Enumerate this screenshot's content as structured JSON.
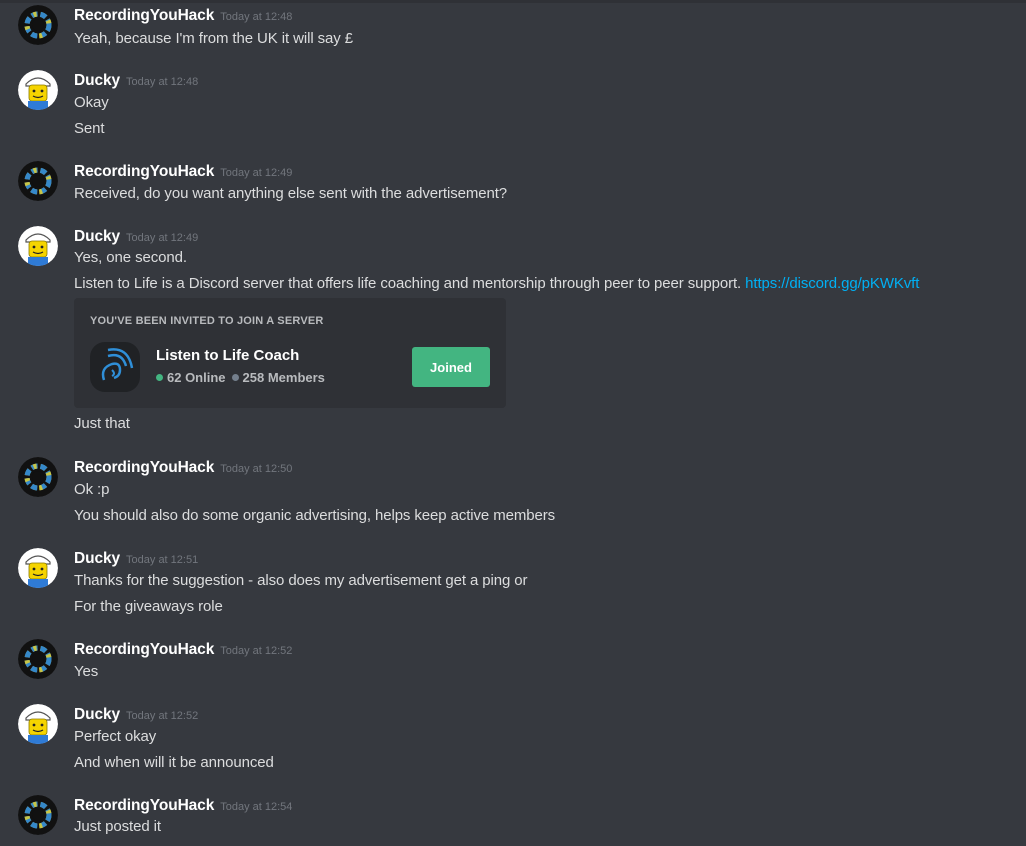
{
  "users": {
    "recording": "RecordingYouHack",
    "ducky": "Ducky"
  },
  "groups": [
    {
      "user": "RecordingYouHack",
      "time": "Today at 12:48",
      "messages": [
        "Yeah, because I'm from the UK it will say £"
      ]
    },
    {
      "user": "Ducky",
      "time": "Today at 12:48",
      "messages": [
        "Okay",
        "Sent"
      ]
    },
    {
      "user": "RecordingYouHack",
      "time": "Today at 12:49",
      "messages": [
        "Received, do you want anything else sent with the advertisement?"
      ]
    },
    {
      "user": "Ducky",
      "time": "Today at 12:49",
      "messages": [
        "Yes, one second.",
        "Listen to Life is a Discord server that offers life coaching and mentorship through peer to peer support. ",
        "Just that"
      ],
      "link": "https://discord.gg/pKWKvft"
    },
    {
      "user": "RecordingYouHack",
      "time": "Today at 12:50",
      "messages": [
        "Ok :p",
        "You should also do some organic advertising, helps keep active members"
      ]
    },
    {
      "user": "Ducky",
      "time": "Today at 12:51",
      "messages": [
        "Thanks for the suggestion - also does my advertisement get a ping or",
        "For the giveaways role"
      ]
    },
    {
      "user": "RecordingYouHack",
      "time": "Today at 12:52",
      "messages": [
        "Yes"
      ]
    },
    {
      "user": "Ducky",
      "time": "Today at 12:52",
      "messages": [
        "Perfect okay",
        "And when will it be announced"
      ]
    },
    {
      "user": "RecordingYouHack",
      "time": "Today at 12:54",
      "messages": [
        "Just posted it"
      ]
    }
  ],
  "invite": {
    "title": "YOU'VE BEEN INVITED TO JOIN A SERVER",
    "server_name": "Listen to Life Coach",
    "online": "62 Online",
    "members": "258 Members",
    "button": "Joined",
    "icon": "sound-waves-ear-icon"
  },
  "colors": {
    "background": "#36393f",
    "username": "#ffffff",
    "timestamp": "#72767d",
    "link": "#00b0f4",
    "joined_button": "#43b581"
  }
}
